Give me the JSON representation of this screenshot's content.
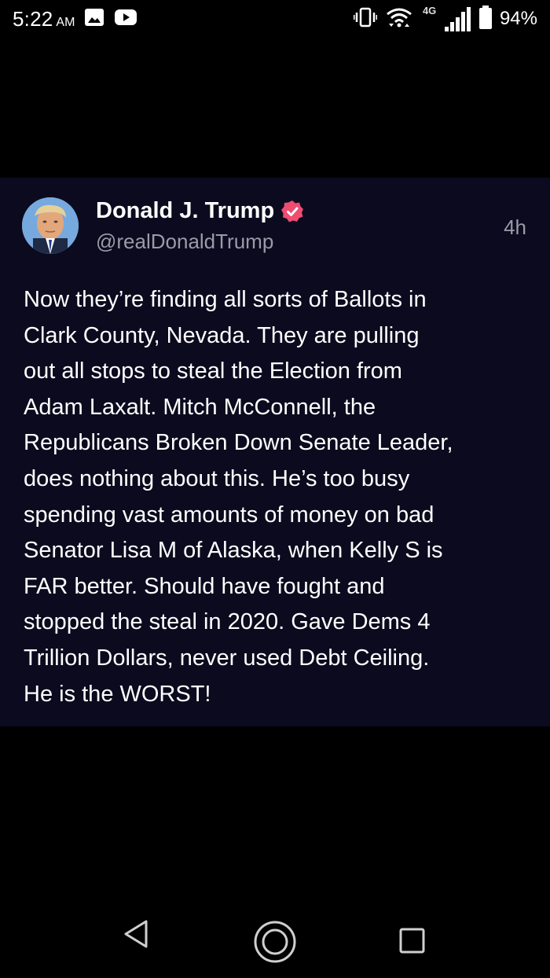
{
  "status_bar": {
    "time": "5:22",
    "ampm": "AM",
    "network_label": "4G",
    "battery": "94%",
    "icons": [
      "gallery-icon",
      "youtube-icon",
      "vibrate-icon",
      "wifi-icon",
      "signal-icon",
      "battery-icon"
    ]
  },
  "post": {
    "author": "Donald J. Trump",
    "handle": "@realDonaldTrump",
    "timestamp": "4h",
    "verified_color": "#ef4c72",
    "text": "Now they’re finding all sorts of Ballots in\nClark County, Nevada. They are pulling\nout all stops to steal the Election from\nAdam Laxalt. Mitch McConnell, the\nRepublicans Broken Down Senate Leader,\ndoes nothing about this. He’s too busy\nspending vast amounts of money on bad\nSenator Lisa M of Alaska, when Kelly S is\nFAR better. Should have fought and\nstopped the steal in 2020. Gave Dems 4\nTrillion Dollars, never used Debt Ceiling.\nHe is the WORST!"
  },
  "nav_bar": {
    "buttons": [
      "back-icon",
      "home-icon",
      "recents-icon"
    ]
  }
}
